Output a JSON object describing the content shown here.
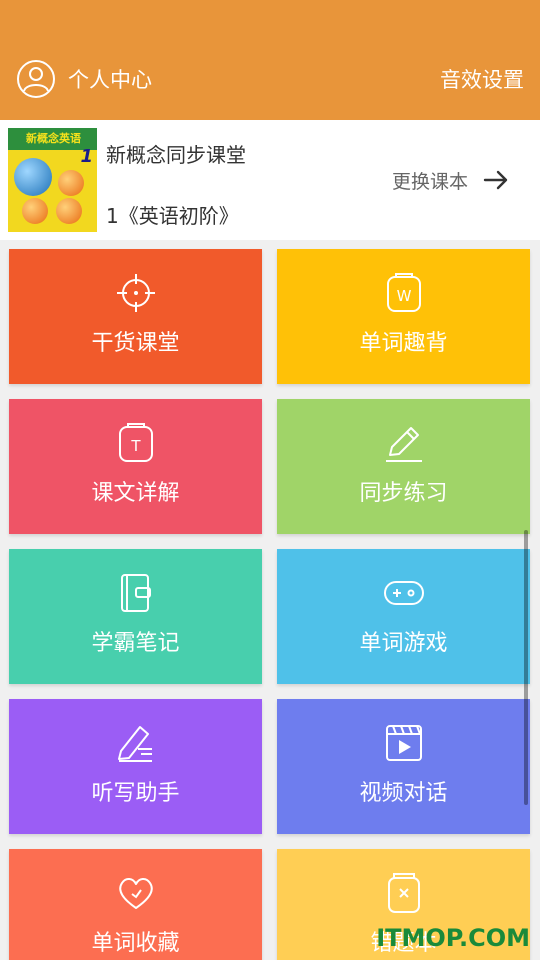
{
  "header": {
    "user_center_label": "个人中心",
    "sound_settings_label": "音效设置",
    "background_color": "#E8953A"
  },
  "book": {
    "title": "新概念同步课堂",
    "subtitle": "1《英语初阶》",
    "change_label": "更换课本",
    "cover_title": "新概念英语",
    "cover_number": "1"
  },
  "tiles": [
    {
      "label": "干货课堂",
      "icon": "target-icon",
      "color": "#F15A2B"
    },
    {
      "label": "单词趣背",
      "icon": "word-card-icon",
      "color": "#FFC107"
    },
    {
      "label": "课文详解",
      "icon": "text-card-icon",
      "color": "#EF5466"
    },
    {
      "label": "同步练习",
      "icon": "pencil-icon",
      "color": "#A0D468"
    },
    {
      "label": "学霸笔记",
      "icon": "notebook-icon",
      "color": "#48CFAD"
    },
    {
      "label": "单词游戏",
      "icon": "gamepad-icon",
      "color": "#4FC1E9"
    },
    {
      "label": "听写助手",
      "icon": "dictation-pen-icon",
      "color": "#9B5DF5"
    },
    {
      "label": "视频对话",
      "icon": "video-icon",
      "color": "#6E7DEE"
    },
    {
      "label": "单词收藏",
      "icon": "heart-icon",
      "color": "#FC6E51"
    },
    {
      "label": "错题本",
      "icon": "error-book-icon",
      "color": "#FFCE54"
    }
  ],
  "watermark": "ITMOP.COM"
}
